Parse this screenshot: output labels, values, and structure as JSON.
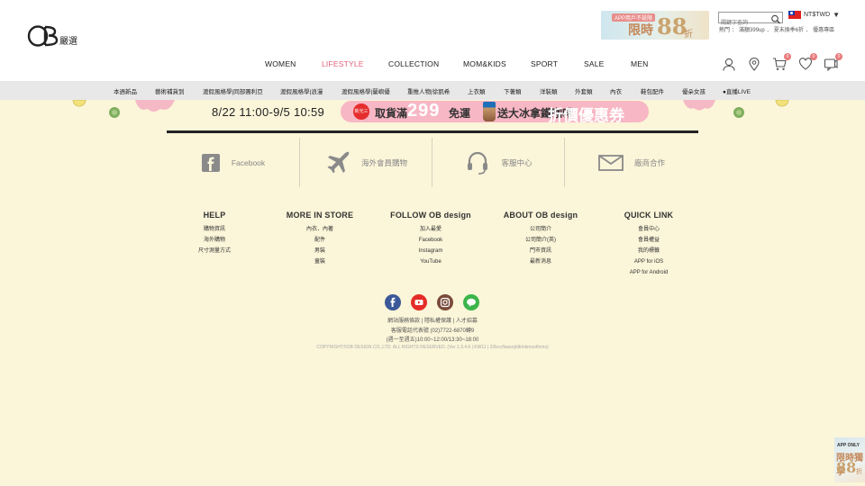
{
  "header": {
    "logo_text": "OB嚴選",
    "app_banner": {
      "small": "APP用戶不設限",
      "big": "限時",
      "number": "88",
      "suffix": "折"
    },
    "search": {
      "placeholder": "關鍵字查詢"
    },
    "hot_links": [
      "熱門",
      "：",
      "滿額399up",
      "．",
      "夏末換季6折",
      "．",
      "優惠專區"
    ],
    "currency": "NT$TWD",
    "currency_arrow": "▼",
    "cart_count": "0",
    "wishlist_count": "0",
    "message_count": "0"
  },
  "nav": {
    "items": [
      {
        "label": "WOMEN"
      },
      {
        "label": "LIFESTYLE",
        "active": true
      },
      {
        "label": "COLLECTION"
      },
      {
        "label": "MOM&KIDS"
      },
      {
        "label": "SPORT"
      },
      {
        "label": "SALE"
      },
      {
        "label": "MEN"
      }
    ]
  },
  "subnav": {
    "items": [
      "本週新品",
      "藝術補貨到",
      "渡假風格學|同部團利亞",
      "渡假風格學|浪漫",
      "渡假風格學|蘭嶼優",
      "重推人物|徐凱希",
      "上衣類",
      "下著類",
      "洋裝類",
      "外套類",
      "內衣",
      "鞋包配件",
      "優朵女孩",
      "●直播LIVE"
    ]
  },
  "promo": {
    "date": "8/22 11:00-9/5 10:59",
    "store_logo": "新光三越",
    "t1": "取貨滿",
    "t2": "299",
    "t3": "免運",
    "t4": "送大冰拿鐵咖啡",
    "t5": "折價優惠券"
  },
  "services": [
    {
      "label": "Facebook",
      "icon": "facebook-square-icon"
    },
    {
      "label": "海外會員購物",
      "icon": "airplane-icon"
    },
    {
      "label": "客服中心",
      "icon": "headset-icon"
    },
    {
      "label": "廠商合作",
      "icon": "envelope-icon"
    }
  ],
  "footer_cols": [
    {
      "title": "HELP",
      "links": [
        "購物資訊",
        "海外購物",
        "尺寸測量方式"
      ]
    },
    {
      "title": "MORE IN STORE",
      "links": [
        "內衣．內著",
        "配件",
        "男裝",
        "童裝"
      ]
    },
    {
      "title": "FOLLOW OB design",
      "links": [
        "加入最愛",
        "Facebook",
        "Instagram",
        "YouTube"
      ]
    },
    {
      "title": "ABOUT OB design",
      "links": [
        "公司簡介",
        "公司簡介(英)",
        "門市資訊",
        "最新消息"
      ]
    },
    {
      "title": "QUICK LINK",
      "links": [
        "會員中心",
        "會員權益",
        "我的標籤",
        "APP for iOS",
        "APP for Android"
      ]
    }
  ],
  "social_icons": [
    "facebook-icon",
    "youtube-icon",
    "instagram-icon",
    "line-icon"
  ],
  "footer_text": {
    "line1": "網站服務條款 | 隱私權保護 | 人才招募",
    "line2": "客服電話代表號 (02)7722-6870轉9",
    "line3": "(週一至週五)10:00~12:00/13:30~18:00",
    "copyright": "COPYRIGHT©OB DESIGN CO.,LTD. ALL RIGHTS RESERVED. (Ver 1.3.4.6 | KW11 | 32bcc/faasnj/dtrinkmoxf/nms)"
  },
  "float_app": {
    "l1": "APP ONLY",
    "l2": "限時獨享",
    "l3": "88",
    "l4": "折"
  },
  "colors": {
    "accent": "#e0637a",
    "background": "#fbf5d9",
    "subnav_bg": "#e8e8e8"
  }
}
